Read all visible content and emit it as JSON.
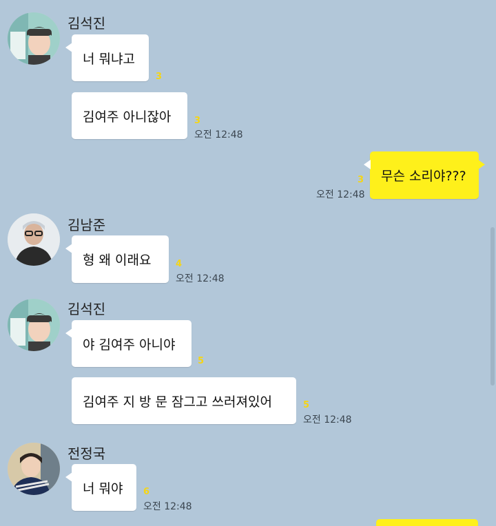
{
  "theme": {
    "background": "#b2c7d9",
    "my_bubble": "#fef01b",
    "other_bubble": "#ffffff",
    "unread_color": "#f5d515"
  },
  "messages": [
    {
      "sender": "김석진",
      "text": "너 뭐냐고",
      "unread": "3",
      "time": ""
    },
    {
      "sender": "김석진",
      "text": "김여주 아니잖아",
      "unread": "3",
      "time": "오전 12:48"
    },
    {
      "sender": "me",
      "text": "무슨 소리야???",
      "unread": "3",
      "time": "오전 12:48"
    },
    {
      "sender": "김남준",
      "text": "형 왜 이래요",
      "unread": "4",
      "time": "오전 12:48"
    },
    {
      "sender": "김석진",
      "text": "야 김여주 아니야",
      "unread": "5",
      "time": ""
    },
    {
      "sender": "김석진",
      "text": "김여주 지 방 문 잠그고 쓰러져있어",
      "unread": "5",
      "time": "오전 12:48"
    },
    {
      "sender": "전정국",
      "text": "너 뭐야",
      "unread": "6",
      "time": "오전 12:48"
    }
  ],
  "senders": {
    "jin": "김석진",
    "namjoon": "김남준",
    "jungkook": "전정국"
  }
}
